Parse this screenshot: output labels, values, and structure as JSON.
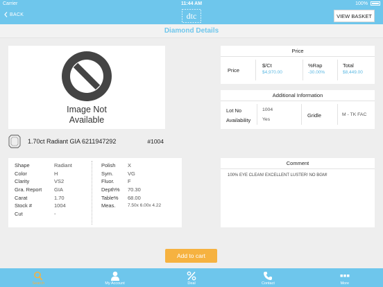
{
  "status_bar": {
    "carrier": "Carrier",
    "time": "11:44 AM",
    "battery": "100%"
  },
  "nav": {
    "back_label": "BACK",
    "logo_text": "dtc",
    "view_basket_label": "VIEW BASKET"
  },
  "page": {
    "title": "Diamond Details"
  },
  "image_placeholder": {
    "line1": "Image Not",
    "line2": "Available"
  },
  "stone": {
    "title": "1.70ct Radiant GIA 6211947292",
    "stock_ref": "#1004"
  },
  "specs_left": [
    {
      "key": "Shape",
      "value": "Radiant"
    },
    {
      "key": "Color",
      "value": "H"
    },
    {
      "key": "Clarity",
      "value": "VS2"
    },
    {
      "key": "Gra. Report",
      "value": "GIA"
    },
    {
      "key": "Carat",
      "value": "1.70"
    },
    {
      "key": "Stock #",
      "value": "1004"
    },
    {
      "key": "Cut",
      "value": "-"
    }
  ],
  "specs_right": [
    {
      "key": "Polish",
      "value": "X"
    },
    {
      "key": "Sym.",
      "value": "VG"
    },
    {
      "key": "Fluor.",
      "value": "F"
    },
    {
      "key": "Depth%",
      "value": "70.30"
    },
    {
      "key": "Table%",
      "value": "68.00"
    },
    {
      "key": "Meas.",
      "value": "7.50x 6.00x 4.22"
    }
  ],
  "price": {
    "heading": "Price",
    "row_label": "Price",
    "per_ct_label": "$/Ct",
    "per_ct_value": "$4,970.00",
    "rap_label": "%Rap",
    "rap_value": "-30.00%",
    "total_label": "Total",
    "total_value": "$8,449.00"
  },
  "additional": {
    "heading": "Additional Information",
    "lot_label": "Lot No",
    "lot_value": "1004",
    "availability_label": "Availability",
    "availability_value": "Yes",
    "girdle_label": "Gridle",
    "girdle_value": "M - TK FAC"
  },
  "comment": {
    "heading": "Comment",
    "text": "100% EYE CLEAN! EXCELLENT LUSTER! NO BGM!"
  },
  "add_to_cart_label": "Add to cart",
  "tabs": [
    {
      "label": "Search",
      "icon": "search-icon"
    },
    {
      "label": "My Account",
      "icon": "user-icon"
    },
    {
      "label": "Deal",
      "icon": "percent-icon"
    },
    {
      "label": "Contact",
      "icon": "phone-icon"
    },
    {
      "label": "More",
      "icon": "more-icon"
    }
  ],
  "colors": {
    "brand": "#6ec6ec",
    "accent": "#f6b240",
    "price_value": "#5bb8e2"
  }
}
